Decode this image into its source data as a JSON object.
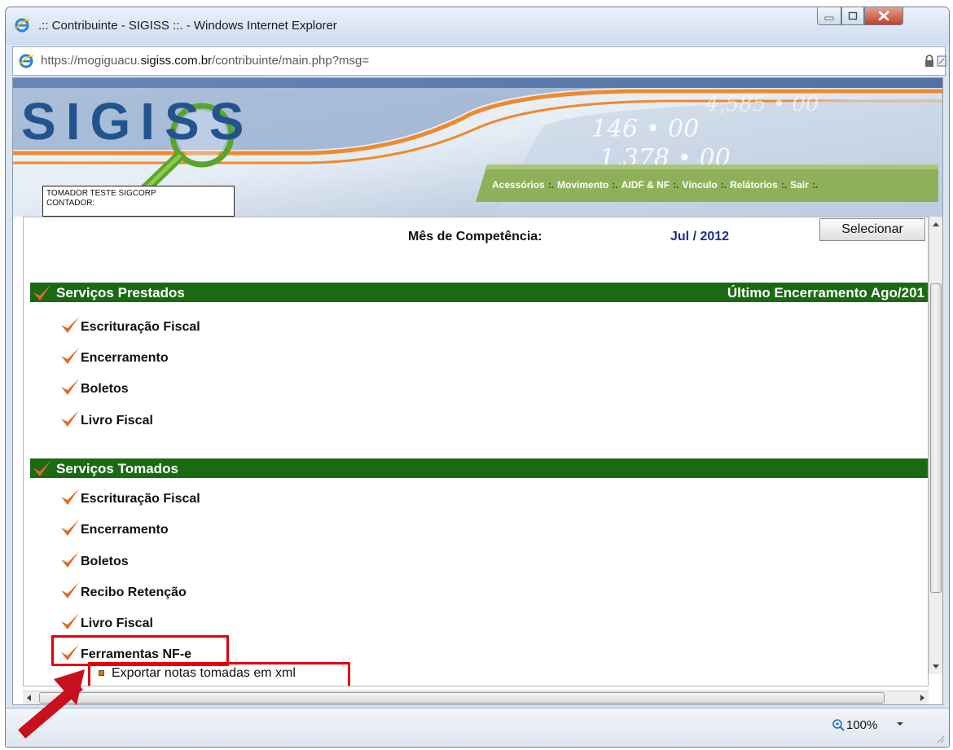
{
  "window": {
    "title": ".:: Contribuinte - SIGISS ::. - Windows Internet Explorer"
  },
  "address": {
    "url_prefix": "https://mogiguacu.",
    "url_domain": "sigiss.com.br",
    "url_path": "/contribuinte/main.php?msg="
  },
  "header": {
    "logo_text": "SIGISS",
    "user_line1": "TOMADOR TESTE SIGCORP",
    "user_line2": "CONTADOR:",
    "menu": [
      "Acessórios",
      "Movimento",
      "AIDF & NF",
      "Vínculo",
      "Relátorios",
      "Sair"
    ],
    "menu_sep": ":."
  },
  "competencia": {
    "label": "Mês de Competência:",
    "value": "Jul / 2012",
    "button": "Selecionar"
  },
  "prestados": {
    "title": "Serviços Prestados",
    "right": "Último Encerramento Ago/201",
    "items": [
      "Escrituração Fiscal",
      "Encerramento",
      "Boletos",
      "Livro Fiscal"
    ]
  },
  "tomados": {
    "title": "Serviços Tomados",
    "items": [
      "Escrituração Fiscal",
      "Encerramento",
      "Boletos",
      "Recibo Retenção",
      "Livro Fiscal",
      "Ferramentas NF-e"
    ],
    "subitem": "Exportar notas tomadas em xml"
  },
  "status": {
    "zoom": "100%"
  },
  "colors": {
    "section_green": "#1a6a14",
    "check_orange": "#e06a26",
    "highlight_red": "#e3000b",
    "menu_green": "#8fb05a",
    "competencia_blue": "#1e2d8c"
  },
  "icons": {
    "browser": "ie-icon",
    "lock": "lock-icon",
    "check": "checkmark-icon",
    "zoom": "magnifier-icon"
  }
}
